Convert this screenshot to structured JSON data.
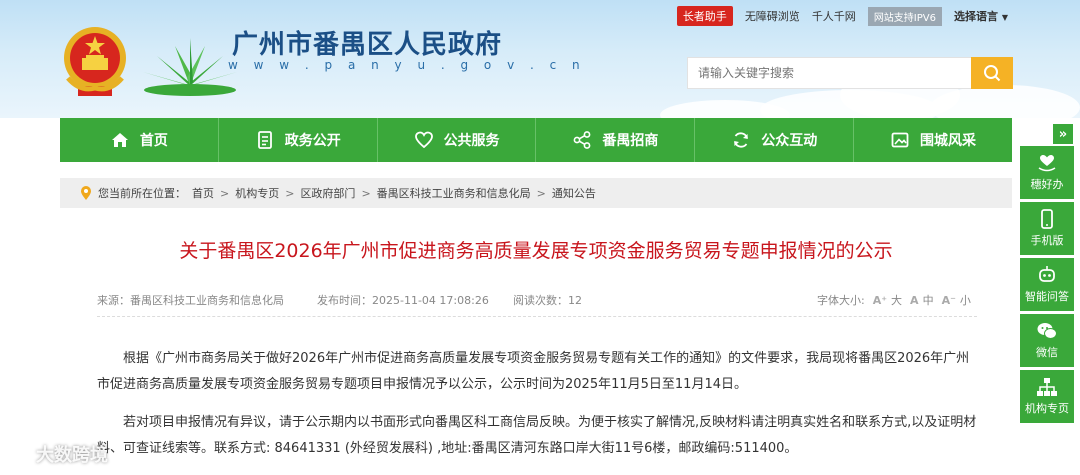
{
  "topbar": {
    "elder": "长者助手",
    "accessibility": "无障碍浏览",
    "millions": "千人千网",
    "ipv6": "网站支持IPV6",
    "language": "选择语言"
  },
  "site": {
    "title": "广州市番禺区人民政府",
    "url": "w w w . p a n y u . g o v . c n"
  },
  "search": {
    "placeholder": "请输入关键字搜索"
  },
  "nav": [
    {
      "label": "首页",
      "icon": "home-icon"
    },
    {
      "label": "政务公开",
      "icon": "document-icon"
    },
    {
      "label": "公共服务",
      "icon": "heart-icon"
    },
    {
      "label": "番禺招商",
      "icon": "network-icon"
    },
    {
      "label": "公众互动",
      "icon": "refresh-icon"
    },
    {
      "label": "围城风采",
      "icon": "image-icon"
    }
  ],
  "float": {
    "items": [
      {
        "label": "穗好办",
        "icon": "heart-hand-icon"
      },
      {
        "label": "手机版",
        "icon": "phone-icon"
      },
      {
        "label": "智能问答",
        "icon": "robot-icon"
      },
      {
        "label": "微信",
        "icon": "wechat-icon"
      },
      {
        "label": "机构专页",
        "icon": "org-chart-icon"
      }
    ]
  },
  "breadcrumb": {
    "prefix": "您当前所在位置：",
    "items": [
      "首页",
      "机构专页",
      "区政府部门",
      "番禺区科技工业商务和信息化局",
      "通知公告"
    ],
    "separator": ">"
  },
  "article": {
    "title": "关于番禺区2026年广州市促进商务高质量发展专项资金服务贸易专题申报情况的公示",
    "source": "来源：番禺区科技工业商务和信息化局",
    "time": "发布时间：2025-11-04 17:08:26",
    "views": "阅读次数：12",
    "font_size_label": "字体大小:",
    "font_large": "大",
    "font_medium": "中",
    "font_small": "小",
    "paragraphs": [
      "根据《广州市商务局关于做好2026年广州市促进商务高质量发展专项资金服务贸易专题有关工作的通知》的文件要求，我局现将番禺区2026年广州市促进商务高质量发展专项资金服务贸易专题项目申报情况予以公示，公示时间为2025年11月5日至11月14日。",
      "若对项目申报情况有异议，请于公示期内以书面形式向番禺区科工商信局反映。为便于核实了解情况,反映材料请注明真实姓名和联系方式,以及证明材料、可查证线索等。联系方式: 84641331 (外经贸发展科) ,地址:番禺区清河东路口岸大街11号6楼，邮政编码:511400。"
    ]
  },
  "watermark": "大数跨境",
  "colors": {
    "nav_green": "#3aa83a",
    "title_red": "#c8161d",
    "search_orange": "#f5b225"
  }
}
